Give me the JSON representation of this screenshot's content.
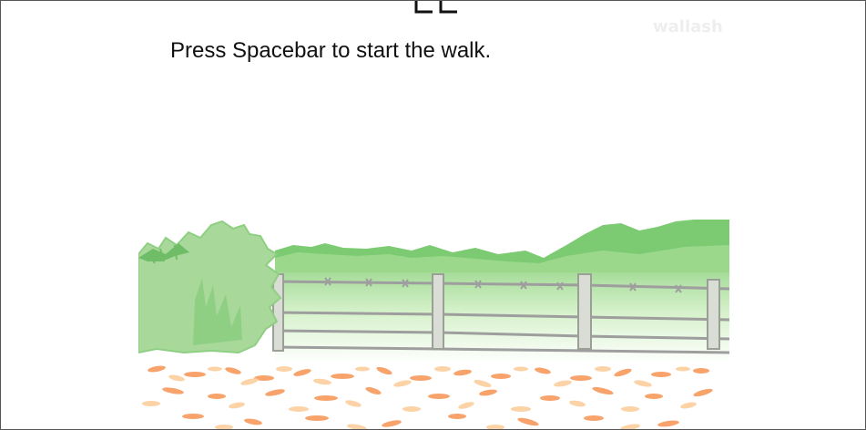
{
  "game": {
    "instruction": "Press Spacebar to start the walk.",
    "watermark": "wallash",
    "start_key": "Spacebar"
  },
  "scene": {
    "elements": [
      "bush",
      "tree-line",
      "barbed-wire-fence",
      "fence-posts",
      "autumn-leaves"
    ],
    "colors": {
      "bush_light": "#a8d99a",
      "bush_mid": "#8fcf83",
      "bush_dark": "#6fbd66",
      "tree_line": "#7ccb73",
      "grass_fade": "#d7f2cc",
      "fence": "#9e9e9e",
      "post": "#d9ddd6",
      "leaf_orange": "#f7a36b",
      "leaf_light": "#fbd3a6"
    }
  }
}
